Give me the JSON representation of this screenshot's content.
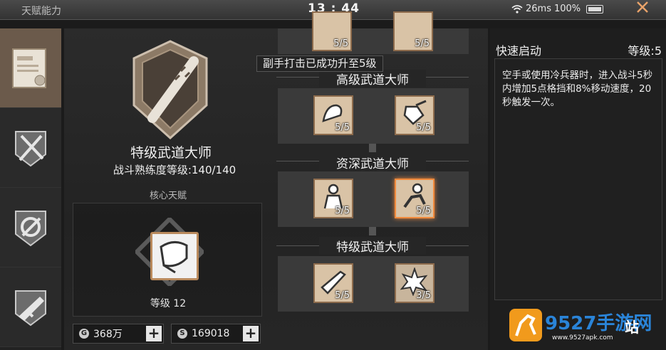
{
  "status_bar": {
    "screen_title": "天赋能力",
    "time": "13 : 44",
    "ping": "26ms",
    "battery": "100%",
    "close_icon": "close-x-icon",
    "accent_color": "#e9a36a"
  },
  "sidebar": {
    "tabs": [
      {
        "icon": "certificate-icon",
        "active": true
      },
      {
        "icon": "melee-weapons-icon",
        "active": false
      },
      {
        "icon": "gear-tools-icon",
        "active": false
      },
      {
        "icon": "firearms-icon",
        "active": false
      }
    ]
  },
  "rank": {
    "title": "特级武道大师",
    "proficiency": "战斗熟练度等级:140/140",
    "emblem_icon": "spiked-bat-emblem-icon"
  },
  "core_talent": {
    "label": "核心天赋",
    "icon": "hand-wrap-icon",
    "level": "等级 12"
  },
  "currency": [
    {
      "icon": "G",
      "value": "368万"
    },
    {
      "icon": "S",
      "value": "169018"
    }
  ],
  "tree": {
    "toast": "副手打击已成功升至5级",
    "top_row": [
      {
        "count": "5/5"
      },
      {
        "count": "5/5"
      }
    ],
    "tiers": [
      {
        "title": "高级武道大师",
        "skills": [
          {
            "count": "5/5",
            "icon": "flex-arm-icon",
            "selected": false
          },
          {
            "count": "5/5",
            "icon": "axe-strike-icon",
            "selected": false
          }
        ]
      },
      {
        "title": "资深武道大师",
        "skills": [
          {
            "count": "5/5",
            "icon": "fighter-stance-icon",
            "selected": false
          },
          {
            "count": "5/5",
            "icon": "sprint-runner-icon",
            "selected": true
          }
        ]
      },
      {
        "title": "特级武道大师",
        "skills": [
          {
            "count": "5/5",
            "icon": "blade-slash-icon",
            "selected": false
          },
          {
            "count": "3/5",
            "icon": "shockwave-icon",
            "selected": false
          }
        ]
      }
    ]
  },
  "info": {
    "name": "快速启动",
    "level": "等级:5",
    "description": "空手或使用冷兵器时，进入战斗5秒内增加5点格挡和8%移动速度，20秒触发一次。"
  },
  "watermark": {
    "text": "9527手游网",
    "url": "www.9527apk.com",
    "stamp": "站"
  }
}
